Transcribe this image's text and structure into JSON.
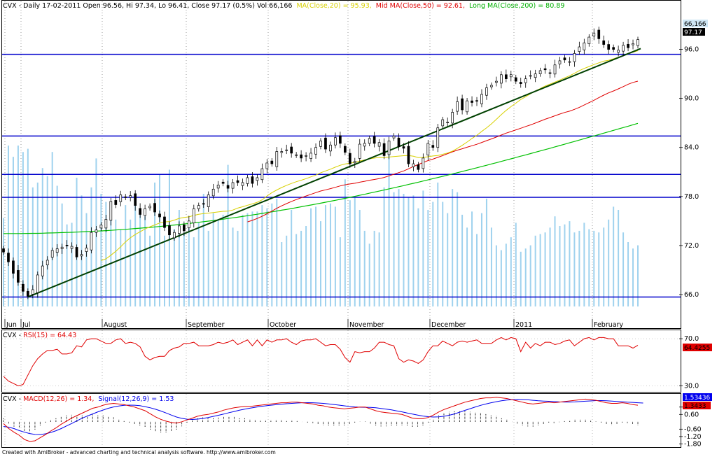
{
  "header": {
    "prefix": "CVX - Daily 17-02-2011 Open 96.56, Hi 97.34, Lo 96.41, Close 97.17 (0.5%) Vol 66,166",
    "ma20": "MA(Close,20) = 95.93,",
    "ma50": "Mid MA(Close,50) = 92.61,",
    "ma200": "Long MA(Close,200) = 80.89"
  },
  "rsi_header": {
    "prefix": "CVX - ",
    "label": "RSI(15) = 64.43"
  },
  "macd_header": {
    "prefix": "CVX - ",
    "macd": "MACD(12,26) = 1.34,",
    "signal": "Signal(12,26,9) = 1.53"
  },
  "badges": {
    "volume": "66,166",
    "close": "97.17",
    "rsi": "64.4255",
    "macd": "1.53436",
    "signal": "1.3433"
  },
  "footer": "Created with AmiBroker - advanced charting and technical analysis software. http://www.amibroker.com",
  "colors": {
    "up": "#ffffff",
    "down": "#000000",
    "volume": "#9fd2ee",
    "ma20": "#d8d000",
    "ma50": "#e00000",
    "ma200": "#00c000",
    "hlines": "#0000cc",
    "trend": "#004000",
    "rsi": "#e00000",
    "macd": "#e00000",
    "signal": "#0000ee",
    "hist": "#000000"
  },
  "chart_data": [
    {
      "type": "candlestick",
      "title": "CVX - Daily 17-02-2011",
      "months": [
        "Jun",
        "Jul",
        "August",
        "September",
        "October",
        "November",
        "December",
        "2011",
        "February"
      ],
      "y_ticks": [
        66.0,
        72.0,
        78.0,
        84.0,
        90.0,
        96.0
      ],
      "ylim": [
        64.2,
        100.5
      ],
      "close": [
        71.2,
        70.0,
        68.6,
        67.5,
        66.4,
        65.8,
        66.6,
        68.4,
        69.5,
        70.2,
        71.4,
        71.6,
        71.8,
        72.0,
        71.9,
        70.6,
        70.9,
        71.7,
        73.6,
        73.9,
        74.5,
        75.2,
        77.4,
        77.0,
        78.2,
        77.9,
        78.1,
        76.9,
        75.8,
        76.5,
        76.8,
        76.1,
        75.5,
        74.2,
        73.3,
        73.6,
        74.4,
        73.8,
        75.0,
        76.5,
        76.9,
        77.1,
        78.2,
        78.9,
        79.4,
        79.6,
        79.0,
        79.7,
        79.7,
        79.7,
        80.3,
        79.6,
        80.3,
        81.4,
        82.1,
        82.0,
        83.5,
        83.5,
        83.7,
        83.3,
        83.1,
        82.7,
        83.0,
        83.3,
        84.0,
        84.8,
        83.8,
        84.3,
        85.2,
        84.5,
        83.4,
        82.0,
        82.3,
        84.4,
        84.5,
        85.1,
        84.5,
        84.6,
        83.0,
        84.8,
        85.4,
        84.1,
        83.9,
        82.0,
        82.0,
        81.3,
        82.7,
        84.5,
        84.0,
        86.4,
        87.4,
        87.1,
        88.3,
        89.6,
        88.6,
        89.7,
        89.5,
        89.7,
        90.5,
        91.3,
        91.6,
        92.1,
        92.9,
        92.4,
        92.9,
        92.1,
        91.8,
        92.4,
        92.8,
        93.0,
        93.4,
        93.5,
        93.1,
        94.1,
        94.6,
        94.7,
        94.5,
        95.5,
        96.3,
        96.8,
        97.5,
        98.0,
        97.3,
        96.6,
        96.0,
        96.0,
        95.9,
        96.5,
        96.2,
        96.7,
        97.2
      ],
      "ma_20": [
        null,
        null,
        null,
        null,
        null,
        null,
        null,
        null,
        null,
        null,
        null,
        null,
        null,
        null,
        null,
        null,
        null,
        null,
        null,
        null,
        70.16,
        70.37,
        70.81,
        71.29,
        71.84,
        72.44,
        72.94,
        73.35,
        73.69,
        74.02,
        74.29,
        74.52,
        74.76,
        74.89,
        74.94,
        75.11,
        75.32,
        75.44,
        75.51,
        75.68,
        75.82,
        75.91,
        75.96,
        76.04,
        76.11,
        76.19,
        76.2,
        76.34,
        76.58,
        76.74,
        76.93,
        77.09,
        77.29,
        77.59,
        78.05,
        78.47,
        78.8,
        79.1,
        79.36,
        79.59,
        79.81,
        79.99,
        80.18,
        80.41,
        80.61,
        80.9,
        81.13,
        81.34,
        81.59,
        81.82,
        81.97,
        82.08,
        82.18,
        82.34,
        82.47,
        82.61,
        82.7,
        82.78,
        82.75,
        82.83,
        82.88,
        82.94,
        82.99,
        83.02,
        82.92,
        82.76,
        82.78,
        82.86,
        82.96,
        83.02,
        83.16,
        83.32,
        83.55,
        83.88,
        84.26,
        84.66,
        85.1,
        85.48,
        85.96,
        86.41,
        86.89,
        87.44,
        88.01,
        88.53,
        88.99,
        89.42,
        89.87,
        90.2,
        90.57,
        90.91,
        91.2,
        91.51,
        91.75,
        92.0,
        92.25,
        92.52,
        92.77,
        93.07,
        93.4,
        93.67,
        93.9,
        94.15,
        94.35,
        94.56,
        94.66,
        94.85,
        95.04,
        95.22,
        95.45,
        95.65,
        95.83
      ],
      "ma_50": [
        null,
        null,
        null,
        null,
        null,
        null,
        null,
        null,
        null,
        null,
        null,
        null,
        null,
        null,
        null,
        null,
        null,
        null,
        null,
        null,
        null,
        null,
        null,
        null,
        null,
        null,
        null,
        null,
        null,
        null,
        null,
        null,
        null,
        null,
        null,
        null,
        null,
        null,
        null,
        null,
        null,
        null,
        null,
        null,
        null,
        null,
        null,
        null,
        null,
        null,
        74.89,
        75.08,
        75.31,
        75.58,
        75.89,
        76.21,
        76.55,
        76.85,
        77.13,
        77.39,
        77.62,
        77.84,
        78.06,
        78.27,
        78.47,
        78.67,
        78.81,
        78.96,
        79.12,
        79.29,
        79.43,
        79.53,
        79.62,
        79.75,
        79.86,
        79.99,
        80.08,
        80.18,
        80.33,
        80.53,
        80.72,
        80.92,
        81.13,
        81.38,
        81.67,
        81.91,
        82.16,
        82.39,
        82.57,
        82.79,
        83.0,
        83.24,
        83.46,
        83.67,
        83.84,
        84.03,
        84.21,
        84.39,
        84.61,
        84.83,
        85.05,
        85.27,
        85.52,
        85.75,
        85.95,
        86.15,
        86.35,
        86.56,
        86.76,
        86.98,
        87.22,
        87.45,
        87.66,
        87.87,
        88.09,
        88.28,
        88.44,
        88.66,
        88.91,
        89.19,
        89.48,
        89.77,
        90.09,
        90.4,
        90.68,
        90.91,
        91.17,
        91.44,
        91.73,
        91.96,
        92.11
      ],
      "ma_200": [
        73.46,
        73.46,
        73.46,
        73.46,
        73.47,
        73.48,
        73.49,
        73.49,
        73.51,
        73.53,
        73.54,
        73.56,
        73.58,
        73.6,
        73.62,
        73.64,
        73.67,
        73.7,
        73.73,
        73.76,
        73.79,
        73.82,
        73.86,
        73.9,
        73.94,
        73.98,
        74.03,
        74.08,
        74.12,
        74.17,
        74.22,
        74.28,
        74.33,
        74.39,
        74.45,
        74.51,
        74.57,
        74.64,
        74.7,
        74.77,
        74.84,
        74.92,
        74.99,
        75.06,
        75.14,
        75.22,
        75.31,
        75.39,
        75.47,
        75.56,
        75.65,
        75.74,
        75.83,
        75.93,
        76.02,
        76.12,
        76.22,
        76.32,
        76.42,
        76.52,
        76.63,
        76.74,
        76.85,
        76.96,
        77.07,
        77.18,
        77.3,
        77.42,
        77.53,
        77.65,
        77.77,
        77.9,
        78.02,
        78.15,
        78.27,
        78.4,
        78.53,
        78.66,
        78.79,
        78.93,
        79.06,
        79.2,
        79.33,
        79.47,
        79.61,
        79.75,
        79.89,
        80.03,
        80.18,
        80.32,
        80.47,
        80.61,
        80.76,
        80.91,
        81.06,
        81.21,
        81.36,
        81.51,
        81.67,
        81.82,
        81.98,
        82.13,
        82.29,
        82.45,
        82.61,
        82.77,
        82.93,
        83.09,
        83.25,
        83.41,
        83.57,
        83.74,
        83.9,
        84.07,
        84.23,
        84.4,
        84.57,
        84.73,
        84.9,
        85.07,
        85.24,
        85.41,
        85.58,
        85.75,
        85.92,
        86.09,
        86.26,
        86.43,
        86.6,
        86.78,
        86.95
      ],
      "volume": [
        55,
        100,
        93,
        100,
        96,
        98,
        74,
        77,
        86,
        81,
        96,
        75,
        64,
        51,
        52,
        80,
        69,
        58,
        74,
        92,
        70,
        65,
        62,
        54,
        48,
        63,
        54,
        69,
        57,
        56,
        44,
        77,
        82,
        44,
        85,
        48,
        60,
        46,
        53,
        43,
        52,
        70,
        47,
        58,
        54,
        57,
        88,
        49,
        47,
        57,
        58,
        59,
        59,
        63,
        61,
        64,
        67,
        40,
        44,
        60,
        45,
        47,
        50,
        61,
        62,
        53,
        63,
        64,
        62,
        43,
        79,
        66,
        68,
        60,
        47,
        39,
        47,
        46,
        74,
        100,
        71,
        73,
        70,
        68,
        69,
        61,
        72,
        60,
        65,
        77,
        65,
        58,
        73,
        71,
        57,
        49,
        59,
        45,
        58,
        67,
        49,
        38,
        35,
        39,
        43,
        52,
        34,
        36,
        38,
        44,
        45,
        46,
        49,
        56,
        50,
        51,
        53,
        46,
        47,
        52,
        48,
        47,
        46,
        49,
        54,
        62,
        60,
        46,
        40,
        36,
        38
      ]
    },
    {
      "type": "line",
      "title": "RSI(15) = 64.43",
      "ylim": [
        26,
        76
      ],
      "y_ticks": [
        30.0,
        70.0
      ],
      "series": [
        {
          "name": "RSI(15)",
          "values": [
            38.0,
            34.0,
            32.0,
            30.0,
            31.0,
            39.0,
            47.0,
            53.0,
            57.0,
            60.0,
            60.0,
            61.0,
            57.0,
            57.0,
            58.0,
            64.0,
            63.0,
            69.0,
            70.0,
            70.0,
            68.0,
            66.0,
            66.0,
            69.0,
            70.0,
            66.0,
            67.0,
            66.0,
            63.0,
            55.0,
            52.0,
            54.0,
            55.0,
            55.0,
            60.0,
            62.0,
            63.0,
            66.0,
            66.0,
            67.0,
            64.0,
            64.0,
            64.0,
            65.0,
            67.0,
            66.0,
            67.0,
            69.0,
            65.0,
            67.0,
            69.0,
            64.0,
            69.0,
            64.0,
            69.0,
            67.0,
            69.0,
            69.0,
            70.0,
            67.0,
            65.0,
            68.0,
            69.0,
            69.0,
            70.0,
            67.0,
            64.0,
            65.0,
            65.0,
            61.0,
            54.0,
            50.0,
            59.0,
            58.0,
            59.0,
            59.0,
            62.0,
            67.0,
            67.0,
            65.0,
            64.0,
            53.0,
            50.0,
            52.0,
            51.0,
            49.0,
            52.0,
            59.0,
            64.0,
            64.0,
            68.0,
            66.0,
            64.0,
            67.0,
            68.0,
            67.0,
            68.0,
            69.0,
            66.0,
            66.0,
            66.0,
            69.0,
            71.0,
            69.0,
            71.0,
            70.0,
            59.0,
            67.0,
            62.0,
            66.0,
            64.0,
            67.0,
            67.0,
            65.0,
            66.0,
            68.0,
            69.0,
            64.0,
            67.0,
            70.0,
            71.0,
            69.0,
            71.0,
            71.0,
            70.0,
            70.0,
            64.0,
            64.0,
            64.0,
            62.0,
            64.43
          ]
        }
      ]
    },
    {
      "type": "line",
      "title": "MACD(12,26) = 1.34, Signal(12,26,9) = 1.53",
      "ylim": [
        -1.95,
        2.1
      ],
      "y_ticks": [
        -1.8,
        -1.2,
        -0.6,
        0.6,
        1.2
      ],
      "y_tick_labels": [
        "-1.80",
        "-1.20",
        "-0.60",
        "0.60",
        "1.20"
      ],
      "series": [
        {
          "name": "MACD(12,26)",
          "values": [
            -0.15,
            -0.55,
            -0.85,
            -1.1,
            -1.45,
            -1.6,
            -1.55,
            -1.3,
            -1.05,
            -0.75,
            -0.5,
            -0.2,
            0.05,
            0.3,
            0.5,
            0.7,
            0.9,
            1.1,
            1.2,
            1.35,
            1.45,
            1.5,
            1.45,
            1.4,
            1.3,
            1.2,
            1.05,
            0.9,
            0.65,
            0.4,
            0.2,
            0.05,
            -0.05,
            -0.1,
            0.0,
            0.15,
            0.3,
            0.45,
            0.55,
            0.6,
            0.7,
            0.8,
            0.95,
            1.05,
            1.15,
            1.2,
            1.25,
            1.25,
            1.3,
            1.35,
            1.4,
            1.45,
            1.5,
            1.55,
            1.55,
            1.6,
            1.6,
            1.55,
            1.5,
            1.45,
            1.35,
            1.3,
            1.2,
            1.15,
            1.1,
            1.05,
            1.1,
            1.15,
            1.2,
            1.2,
            1.05,
            0.9,
            0.8,
            0.75,
            0.7,
            0.65,
            0.6,
            0.45,
            0.3,
            0.25,
            0.25,
            0.35,
            0.55,
            0.8,
            1.0,
            1.15,
            1.3,
            1.45,
            1.6,
            1.7,
            1.8,
            1.9,
            1.95,
            1.95,
            2.0,
            1.95,
            1.9,
            1.8,
            1.7,
            1.6,
            1.5,
            1.45,
            1.5,
            1.55,
            1.6,
            1.55,
            1.6,
            1.65,
            1.7,
            1.75,
            1.8,
            1.85,
            1.8,
            1.75,
            1.65,
            1.55,
            1.5,
            1.5,
            1.55,
            1.5,
            1.4,
            1.35
          ]
        },
        {
          "name": "Signal(12,26,9)",
          "values": [
            -0.38,
            -0.44,
            -0.55,
            -0.72,
            -0.85,
            -0.96,
            -1.03,
            -1.04,
            -0.98,
            -0.87,
            -0.73,
            -0.55,
            -0.34,
            -0.14,
            0.08,
            0.29,
            0.47,
            0.64,
            0.81,
            0.96,
            1.1,
            1.21,
            1.29,
            1.34,
            1.36,
            1.35,
            1.31,
            1.23,
            1.14,
            1.02,
            0.88,
            0.72,
            0.55,
            0.39,
            0.28,
            0.21,
            0.19,
            0.22,
            0.27,
            0.35,
            0.44,
            0.53,
            0.63,
            0.74,
            0.84,
            0.94,
            1.03,
            1.11,
            1.18,
            1.25,
            1.3,
            1.35,
            1.39,
            1.43,
            1.47,
            1.5,
            1.53,
            1.55,
            1.56,
            1.55,
            1.53,
            1.5,
            1.46,
            1.41,
            1.36,
            1.3,
            1.25,
            1.21,
            1.19,
            1.18,
            1.17,
            1.14,
            1.09,
            1.03,
            0.97,
            0.89,
            0.81,
            0.72,
            0.63,
            0.55,
            0.47,
            0.42,
            0.39,
            0.4,
            0.45,
            0.53,
            0.64,
            0.78,
            0.93,
            1.07,
            1.21,
            1.34,
            1.45,
            1.55,
            1.64,
            1.72,
            1.77,
            1.8,
            1.82,
            1.81,
            1.79,
            1.75,
            1.71,
            1.69,
            1.67,
            1.65,
            1.62,
            1.61,
            1.61,
            1.62,
            1.65,
            1.68,
            1.7,
            1.73,
            1.73,
            1.72,
            1.69,
            1.66,
            1.63,
            1.6,
            1.58,
            1.55,
            1.53
          ]
        }
      ]
    }
  ]
}
